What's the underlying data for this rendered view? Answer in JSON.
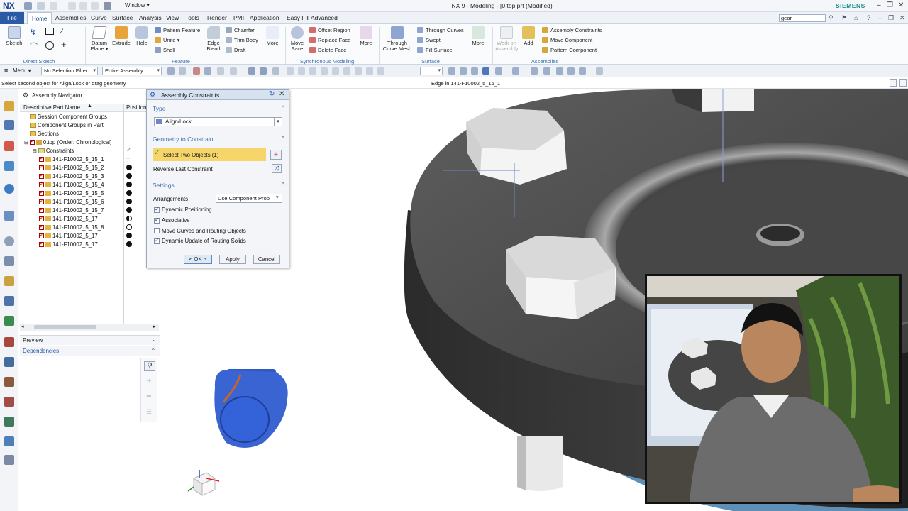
{
  "titlebar": {
    "logo": "NX",
    "window_menu": "Window ▾",
    "title": "NX 9 - Modeling - [0.top.prt (Modified) ]",
    "brand": "SIEMENS",
    "window_controls": [
      "–",
      "❐",
      "✕"
    ]
  },
  "menubar": {
    "tabs": [
      "File",
      "Home",
      "Assemblies",
      "Curve",
      "Surface",
      "Analysis",
      "View",
      "Tools",
      "Render",
      "PMI",
      "Application",
      "Easy Fill Advanced"
    ],
    "search_value": "gear"
  },
  "ribbon": {
    "sketch": "Sketch",
    "direct_sketch": "Direct Sketch",
    "datum_plane": "Datum Plane ▾",
    "extrude": "Extrude",
    "hole": "Hole",
    "pattern_feature": "Pattern Feature",
    "unite": "Unite ▾",
    "shell": "Shell",
    "edge_blend": "Edge Blend",
    "chamfer": "Chamfer",
    "trim_body": "Trim Body",
    "draft": "Draft",
    "more1": "More",
    "feature_group": "Feature",
    "move_face": "Move Face",
    "offset_region": "Offset Region",
    "replace_face": "Replace Face",
    "delete_face": "Delete Face",
    "more2": "More",
    "sync_group": "Synchronous Modeling",
    "through_curve_mesh": "Through Curve Mesh",
    "through_curves": "Through Curves",
    "swept": "Swept",
    "fill_surface": "Fill Surface",
    "more3": "More",
    "surface_group": "Surface",
    "work_on_assembly": "Work on Assembly",
    "add": "Add",
    "assembly_constraints": "Assembly Constraints",
    "move_component": "Move Component",
    "pattern_component": "Pattern Component",
    "assemblies_group": "Assemblies"
  },
  "toolbar": {
    "menu": "Menu ▾",
    "selection_filter": "No Selection Filter",
    "scope": "Entire Assembly"
  },
  "status": {
    "message": "Select second object for Align/Lock or drag geometry",
    "edge": "Edge in 141-F10002_5_15_1"
  },
  "navigator": {
    "title": "Assembly Navigator",
    "col_name": "Descriptive Part Name",
    "col_position": "Position",
    "items": [
      "Session Component Groups",
      "Component Groups in Part",
      "Sections",
      "0.top (Order: Chronological)",
      "Constraints",
      "141-F10002_5_15_1",
      "141-F10002_5_15_2",
      "141-F10002_5_15_3",
      "141-F10002_5_15_4",
      "141-F10002_5_15_5",
      "141-F10002_5_15_6",
      "141-F10002_5_15_7",
      "141-F10002_5_17",
      "141-F10002_5_15_8",
      "141-F10002_5_17",
      "141-F10002_5_17"
    ],
    "preview": "Preview",
    "dependencies": "Dependencies"
  },
  "dialog": {
    "title": "Assembly Constraints",
    "type_section": "Type",
    "type_value": "Align/Lock",
    "geometry_section": "Geometry to Constrain",
    "select_objects": "Select Two Objects (1)",
    "reverse_last": "Reverse Last Constraint",
    "settings_section": "Settings",
    "arrangements_label": "Arrangements",
    "arrangements_value": "Use Component Prop",
    "dynamic_positioning": "Dynamic Positioning",
    "associative": "Associative",
    "move_curves": "Move Curves and Routing Objects",
    "dynamic_update": "Dynamic Update of Routing Solids",
    "ok": "< OK >",
    "apply": "Apply",
    "cancel": "Cancel"
  },
  "colors": {
    "accent": "#2b5aa6",
    "highlight": "#f6d66a",
    "section": "#3e6fb3"
  }
}
